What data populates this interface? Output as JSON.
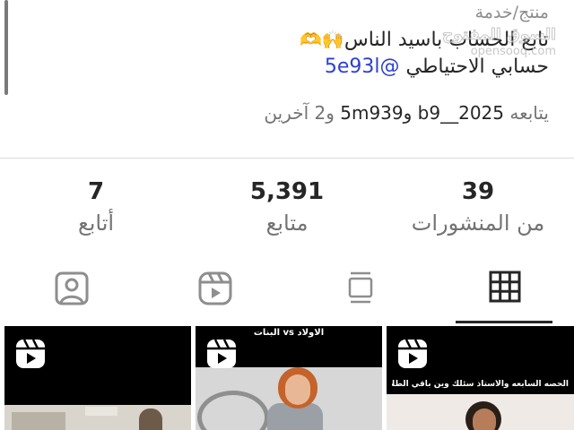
{
  "profile": {
    "category": "منتج/خدمة",
    "bio_line": "تابع الحساب باسيد الناس",
    "bio_emojis": "🙌🫶",
    "backup_text": "حسابي الاحتياطي",
    "backup_mention": "@5e93l",
    "followed_by_prefix": "يتابعه",
    "followed_by_account1": "b9__2025",
    "followed_by_joiner": "و",
    "followed_by_account2": "5m939",
    "followed_by_suffix": "و2 آخرين"
  },
  "watermark": {
    "arabic": "السوق المفتوح",
    "latin": "opensooq.com"
  },
  "stats": {
    "posts_value": "39",
    "posts_label": "من المنشورات",
    "followers_value": "5,391",
    "followers_label": "متابع",
    "following_value": "7",
    "following_label": "أتابع"
  },
  "tabs": [
    {
      "icon": "grid-icon",
      "active": true
    },
    {
      "icon": "feed-icon",
      "active": false
    },
    {
      "icon": "reels-icon",
      "active": false
    },
    {
      "icon": "tagged-icon",
      "active": false
    }
  ],
  "thumbnails": [
    {
      "caption": "",
      "icon": "reel-icon"
    },
    {
      "caption": "الاولاد vs البنات",
      "icon": "reel-icon"
    },
    {
      "caption": "الحصه السابعه والأستاذ سئلك وين باقي الطلاب:",
      "icon": "reel-icon"
    }
  ],
  "colors": {
    "mention": "#2d3fd6",
    "text_primary": "#262626",
    "text_secondary": "#737373",
    "active_tab": "#262626"
  }
}
